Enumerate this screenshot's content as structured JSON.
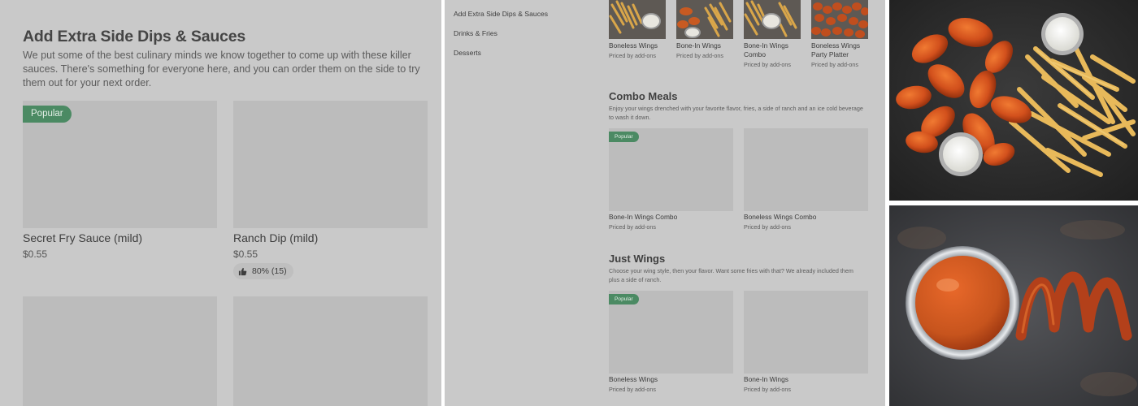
{
  "category_page": {
    "title": "Add Extra Side Dips & Sauces",
    "description": "We put some of the best culinary minds we know together to come up with these killer sauces. There's something for everyone here, and you can order them on the side to try them out for your next order.",
    "popular_badge": "Popular",
    "items": [
      {
        "name": "Secret Fry Sauce (mild)",
        "price": "$0.55"
      },
      {
        "name": "Ranch Dip (mild)",
        "price": "$0.55",
        "rating": "80% (15)"
      }
    ]
  },
  "menu_page": {
    "sidebar": [
      "Add Extra Side Dips & Sauces",
      "Drinks & Fries",
      "Desserts"
    ],
    "top_items": [
      {
        "name": "Boneless Wings",
        "sub": "Priced by add-ons"
      },
      {
        "name": "Bone-In Wings",
        "sub": "Priced by add-ons"
      },
      {
        "name_line1": "Bone-In Wings",
        "name_line2": "Combo",
        "sub": "Priced by add-ons"
      },
      {
        "name_line1": "Boneless Wings",
        "name_line2": "Party Platter",
        "sub": "Priced by add-ons"
      }
    ],
    "sections": [
      {
        "title": "Combo Meals",
        "description": "Enjoy your wings drenched with your favorite flavor, fries, a side of ranch and an ice cold beverage to wash it down.",
        "badge": "Popular",
        "items": [
          {
            "name": "Bone-In Wings Combo",
            "sub": "Priced by add-ons"
          },
          {
            "name": "Boneless Wings Combo",
            "sub": "Priced by add-ons"
          }
        ]
      },
      {
        "title": "Just Wings",
        "description": "Choose your wing style, then your flavor. Want some fries with that? We already included them plus a side of ranch.",
        "badge": "Popular",
        "items": [
          {
            "name": "Boneless Wings",
            "sub": "Priced by add-ons"
          },
          {
            "name": "Bone-In Wings",
            "sub": "Priced by add-ons"
          }
        ]
      }
    ]
  },
  "colors": {
    "panel_bg": "#c9c9c9",
    "placeholder": "#bcbcbc",
    "badge_green": "#4b8a63",
    "sauce_orange": "#c7541d"
  }
}
